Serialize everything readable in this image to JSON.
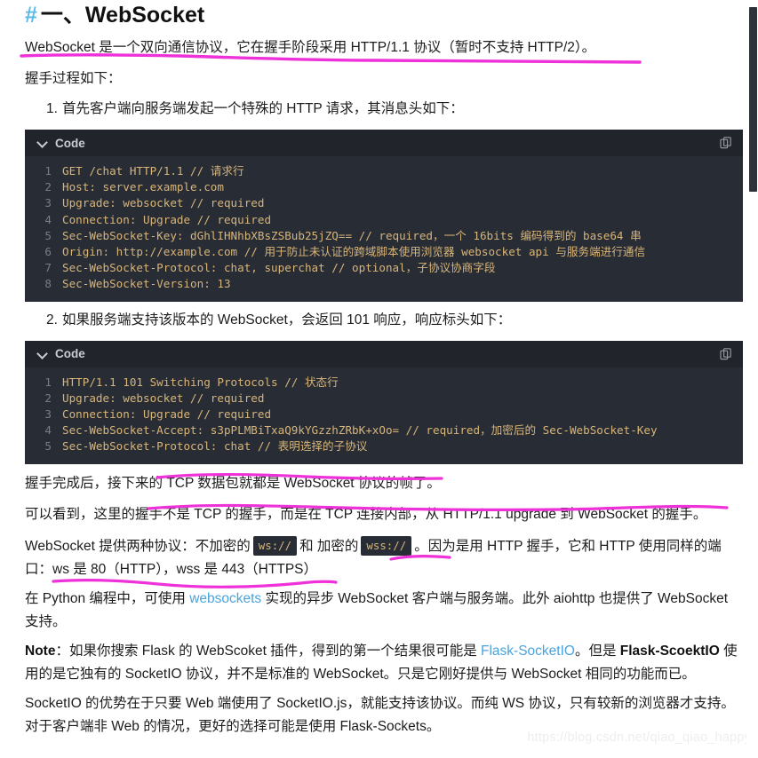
{
  "heading": {
    "hash": "#",
    "text": "一、WebSocket"
  },
  "intro": {
    "p1": "WebSocket 是一个双向通信协议，它在握手阶段采用 HTTP/1.1 协议（暂时不支持 HTTP/2）。",
    "p2": "握手过程如下："
  },
  "steps": [
    {
      "num": "1.",
      "text": "首先客户端向服务端发起一个特殊的 HTTP 请求，其消息头如下："
    },
    {
      "num": "2.",
      "text": "如果服务端支持该版本的 WebSocket，会返回 101 响应，响应标头如下："
    }
  ],
  "code_blocks": [
    {
      "title": "Code",
      "copy_icon": "copy-icon",
      "collapse_icon": "chevron-down-icon",
      "lines": [
        {
          "n": "1",
          "text": "GET /chat HTTP/1.1  // 请求行"
        },
        {
          "n": "2",
          "text": "Host: server.example.com"
        },
        {
          "n": "3",
          "text": "Upgrade: websocket  // required"
        },
        {
          "n": "4",
          "text": "Connection: Upgrade // required"
        },
        {
          "n": "5",
          "text": "Sec-WebSocket-Key: dGhlIHNhbXBsZSBub25jZQ== // required，一个 16bits 编码得到的 base64 串"
        },
        {
          "n": "6",
          "text": "Origin: http://example.com  // 用于防止未认证的跨域脚本使用浏览器 websocket api 与服务端进行通信"
        },
        {
          "n": "7",
          "text": "Sec-WebSocket-Protocol: chat, superchat  // optional，子协议协商字段"
        },
        {
          "n": "8",
          "text": "Sec-WebSocket-Version: 13"
        }
      ]
    },
    {
      "title": "Code",
      "copy_icon": "copy-icon",
      "collapse_icon": "chevron-down-icon",
      "lines": [
        {
          "n": "1",
          "text": "HTTP/1.1 101 Switching Protocols  // 状态行"
        },
        {
          "n": "2",
          "text": "Upgrade: websocket  // required"
        },
        {
          "n": "3",
          "text": "Connection: Upgrade  // required"
        },
        {
          "n": "4",
          "text": "Sec-WebSocket-Accept: s3pPLMBiTxaQ9kYGzzhZRbK+xOo= // required，加密后的 Sec-WebSocket-Key"
        },
        {
          "n": "5",
          "text": "Sec-WebSocket-Protocol: chat // 表明选择的子协议"
        }
      ]
    }
  ],
  "body": {
    "p_after_handshake": "握手完成后，接下来的 TCP 数据包就都是 WebSocket 协议的帧了。",
    "p_seen": "可以看到，这里的握手不是 TCP 的握手，而是在 TCP 连接内部，从 HTTP/1.1 upgrade 到 WebSocket 的握手。",
    "p_protocols": {
      "seg1": "WebSocket 提供两种协议：不加密的",
      "chip1": "ws://",
      "seg2": "和 加密的",
      "chip2": "wss://",
      "seg3": "。因为是用 HTTP 握手，它和 HTTP 使用同样的端口：ws 是 80（HTTP），wss 是 443（HTTPS）"
    },
    "p_python": {
      "seg1": "在 Python 编程中，可使用 ",
      "link": "websockets",
      "seg2": " 实现的异步 WebSocket 客户端与服务端。此外 aiohttp 也提供了 WebSocket 支持。"
    },
    "p_note": {
      "label": "Note",
      "seg1": "：如果你搜索 Flask 的 WebScoket 插件，得到的第一个结果很可能是 ",
      "link": "Flask-SocketIO",
      "seg2": "。但是 ",
      "bold2": "Flask-ScoektIO",
      "seg3": " 使用的是它独有的 SocketIO 协议，并不是标准的 WebSocket。只是它刚好提供与 WebSocket 相同的功能而已。"
    },
    "p_socketio": "SocketIO 的优势在于只要 Web 端使用了 SocketIO.js，就能支持该协议。而纯 WS 协议，只有较新的浏览器才支持。对于客户端非 Web 的情况，更好的选择可能是使用 Flask-Sockets。"
  },
  "watermark": "https://blog.csdn.net/qiao_qiao_happy",
  "colors": {
    "hash": "#5ab9e8",
    "link": "#4ba3dd",
    "code_bg": "#282c34",
    "code_head_bg": "#21252b",
    "code_text": "#d8b579",
    "line_number": "#767e8b",
    "highlighter": "#ef31d9"
  }
}
